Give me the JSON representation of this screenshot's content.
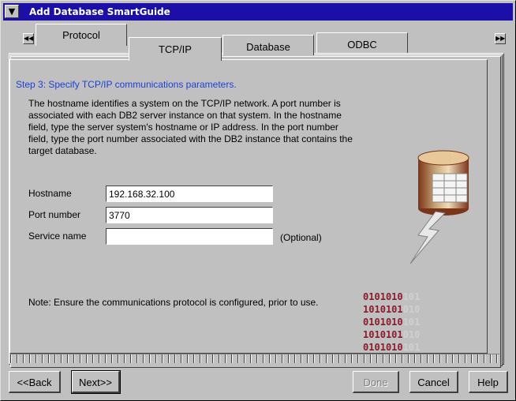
{
  "window": {
    "title": "Add Database SmartGuide",
    "system_menu_glyph": "▼"
  },
  "tabs": [
    {
      "label": "Protocol"
    },
    {
      "label": "TCP/IP",
      "selected": true
    },
    {
      "label": "Database"
    },
    {
      "label": "ODBC"
    }
  ],
  "tab_scroll": {
    "left_icon": "rewind-icon",
    "right_icon": "fast-forward-icon",
    "left_glyph": "◀◀",
    "right_glyph": "▶▶"
  },
  "page": {
    "step": "Step 3: Specify TCP/IP communications parameters.",
    "description": "The hostname identifies a system on the TCP/IP network.  A port number is associated with each DB2 server instance on that system.  In the hostname field, type the server system's hostname or IP address. In the port number field, type the port number associated with the DB2 instance that contains the target database.",
    "hostname_label": "Hostname",
    "hostname_value": "192.168.32.100",
    "port_label": "Port number",
    "port_value": "3770",
    "service_label": "Service name",
    "service_value": "",
    "optional": "(Optional)",
    "note": "Note: Ensure the communications protocol is configured, prior to use."
  },
  "art": {
    "binary_rows": [
      "0101010101",
      "1010101010",
      "0101010101",
      "1010101010",
      "0101010101"
    ],
    "colors": {
      "binary": "#8b1a2b",
      "binary_fade": "#d0d0d0",
      "cylinder": "#c8a878",
      "cylinder_dark": "#7a3418"
    }
  },
  "buttons": {
    "back": "<<Back",
    "next": "Next>>",
    "done": "Done",
    "cancel": "Cancel",
    "help": "Help"
  },
  "colors": {
    "title_bar": "#1b0fa8",
    "step_text": "#1b3fd8"
  }
}
